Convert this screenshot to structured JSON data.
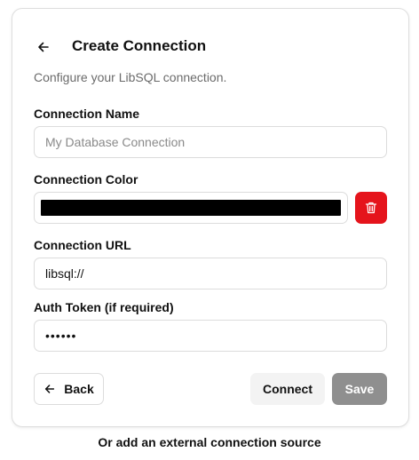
{
  "header": {
    "title": "Create Connection",
    "subtitle": "Configure your LibSQL connection."
  },
  "form": {
    "name": {
      "label": "Connection Name",
      "placeholder": "My Database Connection",
      "value": ""
    },
    "color": {
      "label": "Connection Color",
      "value": "#000000"
    },
    "url": {
      "label": "Connection URL",
      "value": "libsql://"
    },
    "token": {
      "label": "Auth Token (if required)",
      "value": "......"
    }
  },
  "actions": {
    "back_label": "Back",
    "connect_label": "Connect",
    "save_label": "Save"
  },
  "footer": {
    "link_label": "Or add an external connection source"
  },
  "colors": {
    "accent_danger": "#e5141c",
    "save_disabled": "#8f8f8f",
    "connect_bg": "#f3f3f3"
  },
  "icons": {
    "back": "arrow-left-icon",
    "delete": "trash-icon"
  }
}
